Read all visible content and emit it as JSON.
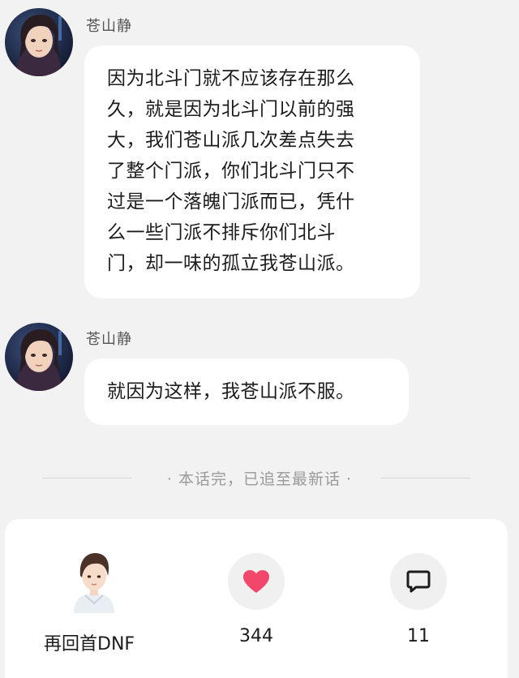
{
  "messages": [
    {
      "sender": "苍山静",
      "lines": [
        "因为北斗门就不应该存在那么",
        "久，就是因为北斗门以前的强",
        "大，我们苍山派几次差点失去",
        "了整个门派，你们北斗门只不",
        "过是一个落魄门派而已，凭什",
        "么一些门派不排斥你们北斗",
        "门，却一味的孤立我苍山派。"
      ]
    },
    {
      "sender": "苍山静",
      "lines": [
        "就因为这样，我苍山派不服。"
      ]
    }
  ],
  "divider": {
    "text": "· 本话完，已追至最新话 ·"
  },
  "footer": {
    "author_name": "再回首DNF",
    "like_count": "344",
    "comment_count": "11"
  },
  "colors": {
    "background": "#f2f2f2",
    "bubble": "#ffffff",
    "like_heart": "#f2476a",
    "icon_circle": "#f0f0f0"
  },
  "icons": {
    "like": "heart-icon",
    "comment": "comment-icon"
  }
}
